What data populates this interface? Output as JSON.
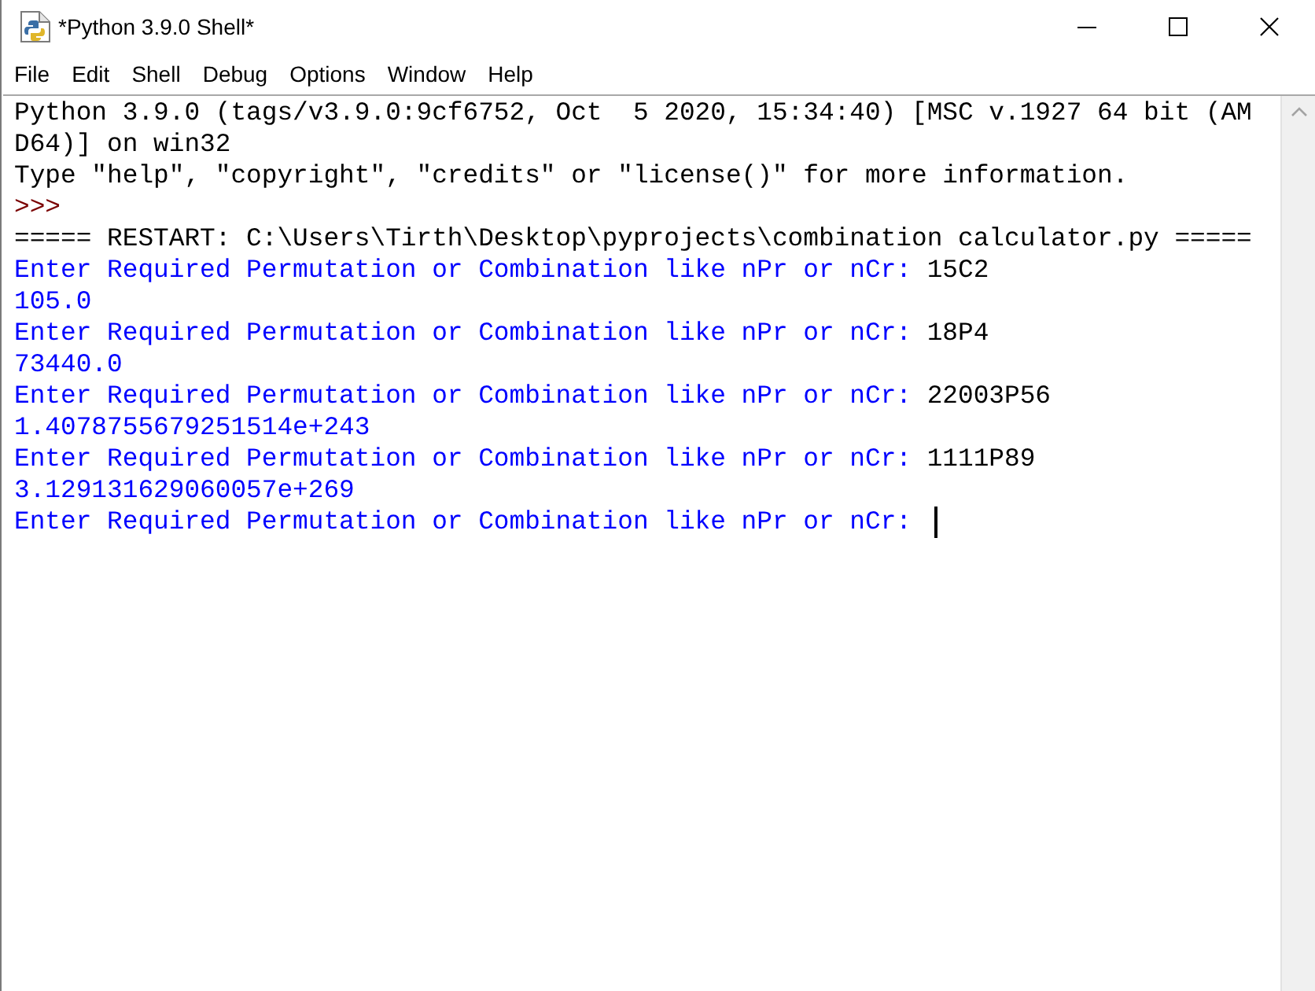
{
  "window": {
    "title": "*Python 3.9.0 Shell*"
  },
  "menu": [
    "File",
    "Edit",
    "Shell",
    "Debug",
    "Options",
    "Window",
    "Help"
  ],
  "shell": {
    "lines": [
      {
        "segments": [
          {
            "kind": "banner",
            "text": "Python 3.9.0 (tags/v3.9.0:9cf6752, Oct  5 2020, 15:34:40) [MSC v.1927 64 bit (AM"
          }
        ]
      },
      {
        "segments": [
          {
            "kind": "banner",
            "text": "D64)] on win32"
          }
        ]
      },
      {
        "segments": [
          {
            "kind": "banner",
            "text": "Type \"help\", \"copyright\", \"credits\" or \"license()\" for more information."
          }
        ]
      },
      {
        "segments": [
          {
            "kind": "prompt",
            "text": ">>>"
          }
        ]
      },
      {
        "segments": [
          {
            "kind": "restart",
            "text": "===== RESTART: C:\\Users\\Tirth\\Desktop\\pyprojects\\combination calculator.py ====="
          }
        ]
      },
      {
        "segments": [
          {
            "kind": "stdout",
            "text": "Enter Required Permutation or Combination like nPr or nCr:"
          },
          {
            "kind": "stdin",
            "text": "15C2"
          }
        ]
      },
      {
        "segments": [
          {
            "kind": "stdout",
            "text": "105.0"
          }
        ]
      },
      {
        "segments": [
          {
            "kind": "stdout",
            "text": "Enter Required Permutation or Combination like nPr or nCr:"
          },
          {
            "kind": "stdin",
            "text": "18P4"
          }
        ]
      },
      {
        "segments": [
          {
            "kind": "stdout",
            "text": "73440.0"
          }
        ]
      },
      {
        "segments": [
          {
            "kind": "stdout",
            "text": "Enter Required Permutation or Combination like nPr or nCr:"
          },
          {
            "kind": "stdin",
            "text": "22003P56"
          }
        ]
      },
      {
        "segments": [
          {
            "kind": "stdout",
            "text": "1.4078755679251514e+243"
          }
        ]
      },
      {
        "segments": [
          {
            "kind": "stdout",
            "text": "Enter Required Permutation or Combination like nPr or nCr:"
          },
          {
            "kind": "stdin",
            "text": "1111P89"
          }
        ]
      },
      {
        "segments": [
          {
            "kind": "stdout",
            "text": "3.129131629060057e+269"
          }
        ]
      },
      {
        "segments": [
          {
            "kind": "stdout",
            "text": "Enter Required Permutation or Combination like nPr or nCr:"
          }
        ]
      }
    ],
    "cursor": true
  }
}
